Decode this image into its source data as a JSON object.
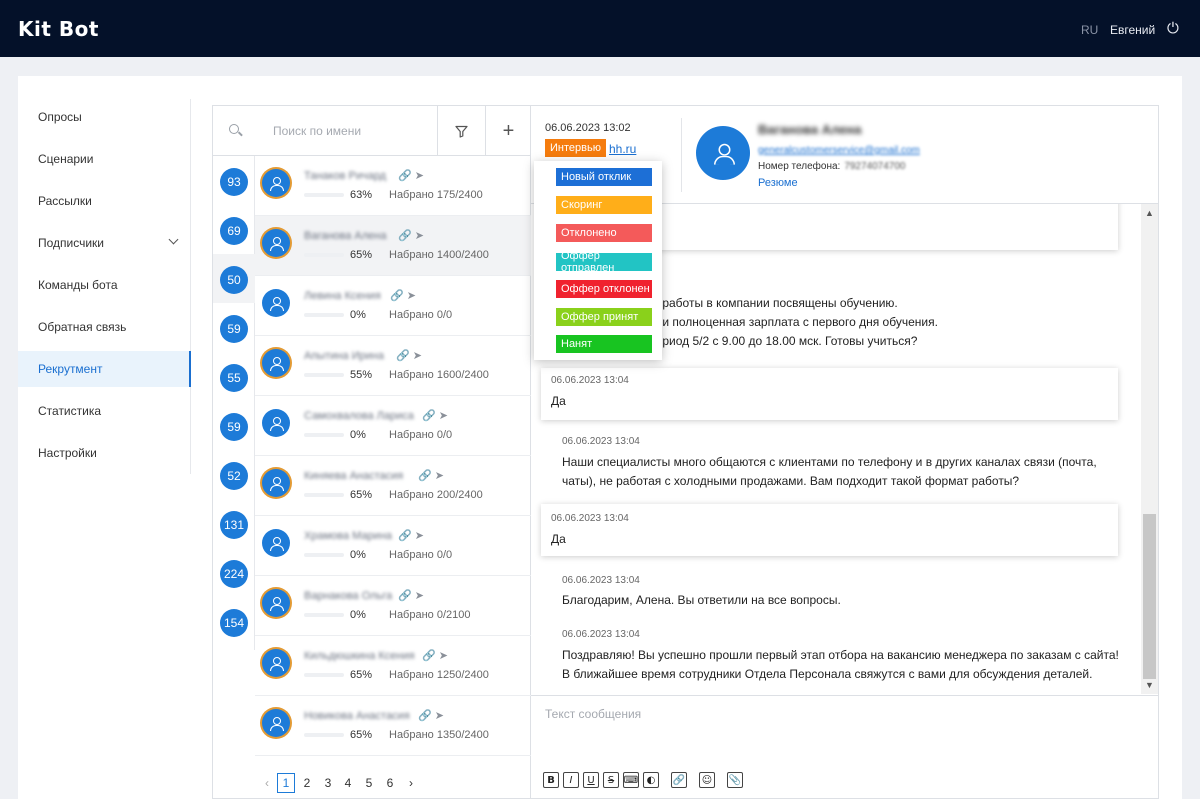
{
  "header": {
    "logo": "Kit Bot",
    "language": "RU",
    "user_name": "Евгений",
    "logout_icon": "logout-icon"
  },
  "sidebar": {
    "items": [
      {
        "label": "Опросы"
      },
      {
        "label": "Сценарии"
      },
      {
        "label": "Рассылки"
      },
      {
        "label": "Подписчики",
        "expandable": true
      },
      {
        "label": "Команды бота"
      },
      {
        "label": "Обратная связь"
      },
      {
        "label": "Рекрутмент",
        "active": true
      },
      {
        "label": "Статистика"
      },
      {
        "label": "Настройки"
      }
    ]
  },
  "search": {
    "placeholder": "Поиск по имени"
  },
  "badges": [
    "93",
    "69",
    "50",
    "59",
    "55",
    "59",
    "52",
    "131",
    "224",
    "154"
  ],
  "candidates": [
    {
      "name": "Танаков Ричард",
      "percent": "63%",
      "progress": 0.63,
      "scored": "Набрано 175/2400"
    },
    {
      "name": "Ваганова Алена",
      "percent": "65%",
      "progress": 0.65,
      "scored": "Набрано 1400/2400"
    },
    {
      "name": "Левина Ксения",
      "percent": "0%",
      "progress": 0,
      "scored": "Набрано 0/0"
    },
    {
      "name": "Апытина Ирина",
      "percent": "55%",
      "progress": 0.55,
      "scored": "Набрано 1600/2400"
    },
    {
      "name": "Самохвалова Лариса",
      "percent": "0%",
      "progress": 0,
      "scored": "Набрано 0/0"
    },
    {
      "name": "Киняева Анастасия",
      "percent": "65%",
      "progress": 0.65,
      "scored": "Набрано 200/2400"
    },
    {
      "name": "Храмова Марина",
      "percent": "0%",
      "progress": 0,
      "scored": "Набрано 0/0"
    },
    {
      "name": "Варнакова Ольга",
      "percent": "0%",
      "progress": 0,
      "scored": "Набрано 0/2100"
    },
    {
      "name": "Кильдюшкина Ксения",
      "percent": "65%",
      "progress": 0.65,
      "scored": "Набрано 1250/2400"
    },
    {
      "name": "Новикова Анастасия",
      "percent": "65%",
      "progress": 0.65,
      "scored": "Набрано 1350/2400"
    }
  ],
  "pagination": {
    "prev": "‹",
    "pages": [
      "1",
      "2",
      "3",
      "4",
      "5",
      "6"
    ],
    "active": "1",
    "next": "›"
  },
  "chat_header": {
    "date": "06.06.2023 13:02",
    "status": "Интервью",
    "source": "hh.ru",
    "name": "Ваганова Алена",
    "email": "generalcustomerservice@gmail.com",
    "phone_label": "Номер телефона:",
    "phone": "79274074700",
    "resume": "Резюме"
  },
  "messages": [
    {
      "text": "... работы в компании посвящены обучению.\n... и полноценная зарплата с первого дня обучения.\n... риод 5/2 с 9.00 до 18.00 мск. Готовы учиться?"
    },
    {
      "time": "06.06.2023 13:04",
      "text": "Да",
      "own": true
    },
    {
      "time": "06.06.2023 13:04",
      "text": "Наши специалисты много общаются с клиентами по телефону и в других каналах связи (почта,\nчаты), не работая с холодными продажами. Вам подходит такой формат работы?"
    },
    {
      "time": "06.06.2023 13:04",
      "text": "Да",
      "own": true
    },
    {
      "time": "06.06.2023 13:04",
      "text": "Благодарим, Алена. Вы ответили на все вопросы."
    },
    {
      "time": "06.06.2023 13:04",
      "text": "Поздравляю! Вы успешно прошли первый этап отбора на вакансию менеджера по заказам с сайта!\nВ ближайшее время сотрудники Отдела Персонала свяжутся с вами для обсуждения деталей."
    }
  ],
  "compose": {
    "placeholder": "Текст сообщения",
    "tools": [
      {
        "label": "B",
        "icon": "bold-icon"
      },
      {
        "label": "I",
        "icon": "italic-icon"
      },
      {
        "label": "U",
        "icon": "underline-icon"
      },
      {
        "label": "S",
        "icon": "strikethrough-icon"
      },
      {
        "label": "⌨",
        "icon": "code-icon"
      },
      {
        "label": "◐",
        "icon": "spoiler-icon"
      },
      {
        "label": "🔗",
        "icon": "link-icon"
      },
      {
        "label": "☺",
        "icon": "emoji-icon"
      },
      {
        "label": "📎",
        "icon": "attach-icon"
      }
    ]
  },
  "status_dropdown": {
    "options": [
      {
        "label": "Новый отклик",
        "color": "#1d6fd6"
      },
      {
        "label": "Скоринг",
        "color": "#ffae19"
      },
      {
        "label": "Отклонено",
        "color": "#f45a5a"
      },
      {
        "label": "Оффер отправлен",
        "color": "#22c4c4"
      },
      {
        "label": "Оффер отклонен",
        "color": "#f0222e"
      },
      {
        "label": "Оффер принят",
        "color": "#8ad11b"
      },
      {
        "label": "Нанят",
        "color": "#18c421"
      }
    ]
  }
}
